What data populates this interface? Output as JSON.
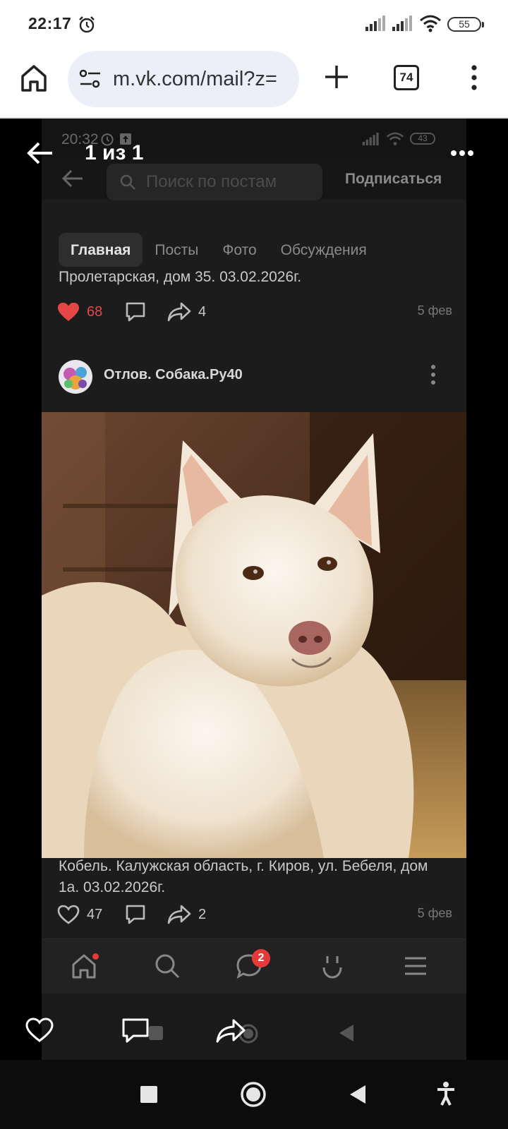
{
  "status_bar": {
    "time": "22:17",
    "battery": "55"
  },
  "browser": {
    "url": "m.vk.com/mail?z=",
    "tab_count": "74"
  },
  "viewer": {
    "title": "1 из 1"
  },
  "inner_app": {
    "time": "20:32",
    "battery": "43",
    "search_placeholder": "Поиск по постам",
    "subscribe": "Подписаться",
    "tabs": [
      "Главная",
      "Посты",
      "Фото",
      "Обсуждения"
    ],
    "post1": {
      "text": "Пролетарская, дом 35.  03.02.2026г.",
      "likes": "68",
      "shares": "4",
      "date": "5 фев"
    },
    "author": "Отлов. Собака.Ру40",
    "post2": {
      "text": "Кобель. Калужская область, г. Киров, ул. Бебеля, дом 1а.  03.02.2026г.",
      "likes": "47",
      "shares": "2",
      "date": "5 фев"
    },
    "messages_badge": "2"
  },
  "colors": {
    "like_active": "#e64646",
    "badge": "#e63a3a",
    "background": "#1c1c1c"
  }
}
